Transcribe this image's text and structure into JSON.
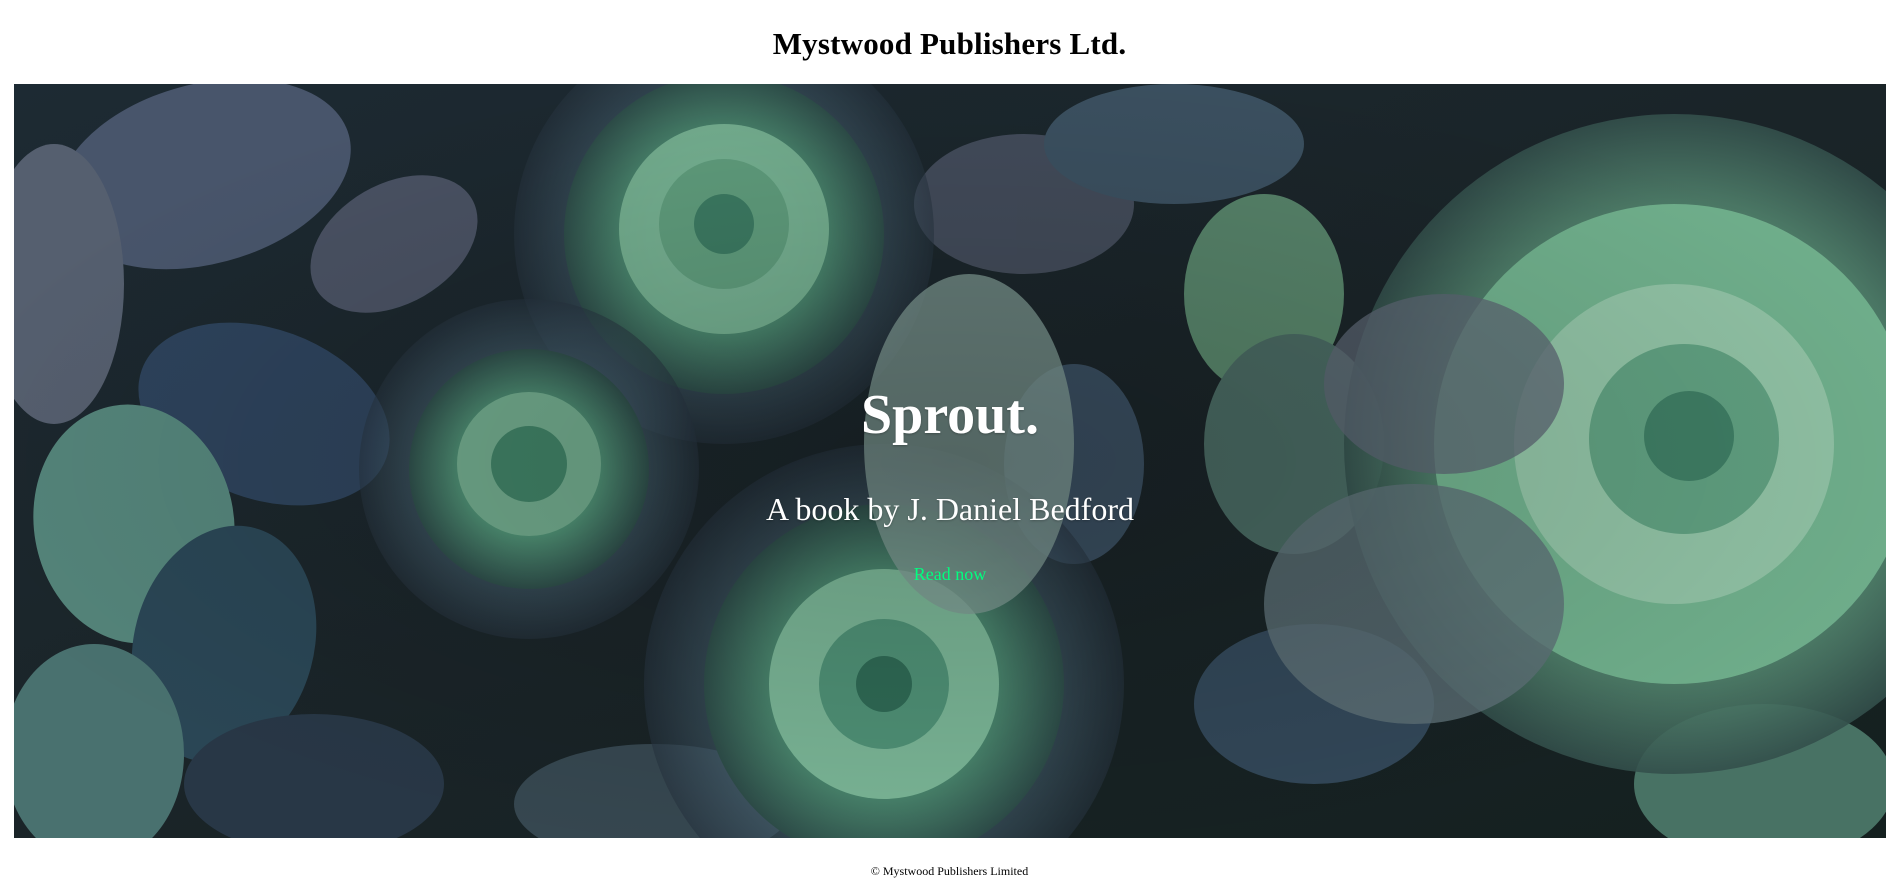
{
  "header": {
    "title": "Mystwood Publishers Ltd."
  },
  "hero": {
    "background_image": "succulents-photo",
    "book_title": "Sprout.",
    "byline": "A book by J. Daniel Bedford",
    "cta_label": "Read now",
    "cta_color": "#00ff7f"
  },
  "footer": {
    "copyright": "© Mystwood Publishers Limited"
  }
}
